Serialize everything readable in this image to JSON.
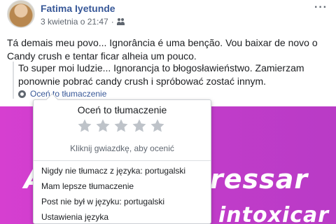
{
  "post": {
    "author": "Fatima Iyetunde",
    "date": "3 kwietnia o 21:47",
    "audience_icon": "friends-icon",
    "more_label": "···",
    "text": "Tá demais meu povo... Ignorância é uma benção. Vou baixar de novo o Candy crush e tentar ficar alheia um pouco."
  },
  "translation": {
    "text": "To super moi ludzie... Ignorancja to błogosławieństwo. Zamierzam ponownie pobrać candy crush i spróbować zostać innym.",
    "rate_link": "Oceń to tłumaczenie"
  },
  "banner": {
    "color": "#c93dcc",
    "line1_left": "A",
    "line1_right": "ressar",
    "line2_right": "intoxicar"
  },
  "popup": {
    "title": "Oceń to tłumaczenie",
    "star_count": 5,
    "star_color": "#bec3c9",
    "hint": "Kliknij gwiazdkę, aby ocenić",
    "menu_items": [
      "Nigdy nie tłumacz z języka: portugalski",
      "Mam lepsze tłumaczenie",
      "Post nie był w języku: portugalski",
      "Ustawienia języka"
    ]
  }
}
